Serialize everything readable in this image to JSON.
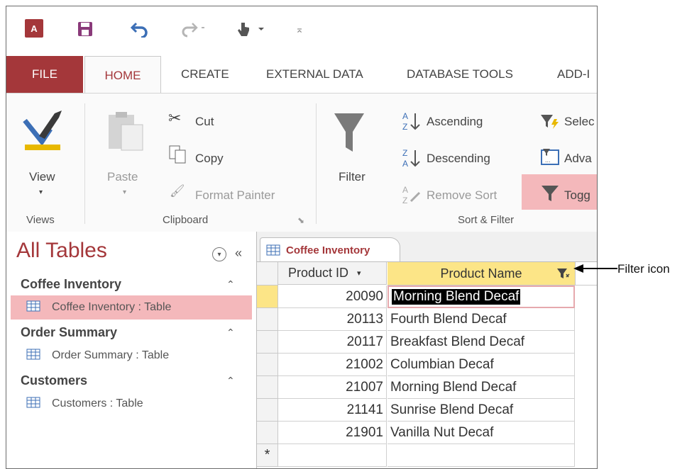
{
  "quick_access": {
    "icons": [
      "access-logo-icon",
      "save-icon",
      "undo-icon",
      "redo-icon",
      "touch-mode-icon",
      "customize-qat-icon"
    ],
    "app_logo_text": "A"
  },
  "ribbon_tabs": [
    "FILE",
    "HOME",
    "CREATE",
    "EXTERNAL DATA",
    "DATABASE TOOLS",
    "ADD-I"
  ],
  "ribbon": {
    "views": {
      "view_label": "View",
      "group_label": "Views"
    },
    "clipboard": {
      "paste_label": "Paste",
      "cut_label": "Cut",
      "copy_label": "Copy",
      "format_painter_label": "Format Painter",
      "group_label": "Clipboard"
    },
    "sort_filter": {
      "filter_label": "Filter",
      "ascending_label": "Ascending",
      "descending_label": "Descending",
      "remove_sort_label": "Remove Sort",
      "selection_label": "Selec",
      "advanced_label": "Adva",
      "toggle_label": "Togg",
      "group_label": "Sort & Filter"
    }
  },
  "nav_pane": {
    "title": "All Tables",
    "groups": [
      {
        "name": "Coffee Inventory",
        "item": "Coffee Inventory : Table",
        "selected": true
      },
      {
        "name": "Order Summary",
        "item": "Order Summary : Table",
        "selected": false
      },
      {
        "name": "Customers",
        "item": "Customers : Table",
        "selected": false
      }
    ]
  },
  "document": {
    "tab_title": "Coffee Inventory",
    "columns": [
      "Product ID",
      "Product Name"
    ],
    "rows": [
      {
        "id": "20090",
        "name": "Morning Blend Decaf"
      },
      {
        "id": "20113",
        "name": "Fourth Blend Decaf"
      },
      {
        "id": "20117",
        "name": "Breakfast Blend Decaf"
      },
      {
        "id": "21002",
        "name": "Columbian Decaf"
      },
      {
        "id": "21007",
        "name": "Morning Blend Decaf"
      },
      {
        "id": "21141",
        "name": "Sunrise Blend Decaf"
      },
      {
        "id": "21901",
        "name": "Vanilla Nut Decaf"
      }
    ],
    "new_row_marker": "*"
  },
  "annotation": "Filter icon",
  "colors": {
    "access_red": "#a4373a",
    "highlight_pink": "#f4b8bb",
    "column_highlight": "#fce587",
    "selected_cell": "#000000"
  }
}
